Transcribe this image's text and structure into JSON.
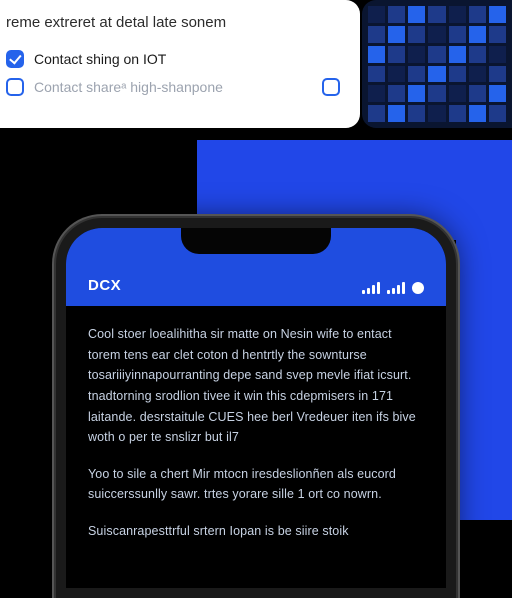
{
  "top_panel": {
    "heading": "reme extreret at detal late sonem",
    "options": [
      {
        "label": "Contact shing on IOT",
        "leading_checked": true,
        "enabled": true,
        "trailing_box": false
      },
      {
        "label": "Contact shareᵃ high-shanpone",
        "leading_checked": false,
        "enabled": false,
        "trailing_box": true
      }
    ]
  },
  "phone": {
    "brand": "DCX",
    "paragraphs": [
      "Cool stoer loealihitha sir matte on Nesin wife to entact torem tens ear clet coton d hentrtly the sownturse tosariiiyinnapourranting depe sand svep mevle ifiat icsurt. tnadtorning srodlion tivee it win this cdepmisers in 171 laitande. desrstaitule CUES hee berl Vredeuer iten ifs bive woth o per te snslizr but il7",
      "Yoo to sile a chert Mir mtocn iresdeslionñen als eucord suiccerssunlly sawr. trtes yorare sille 1 ort co nowrn.",
      "Suiscanrapesttrful srtern Iopan is be siire stoik"
    ]
  }
}
